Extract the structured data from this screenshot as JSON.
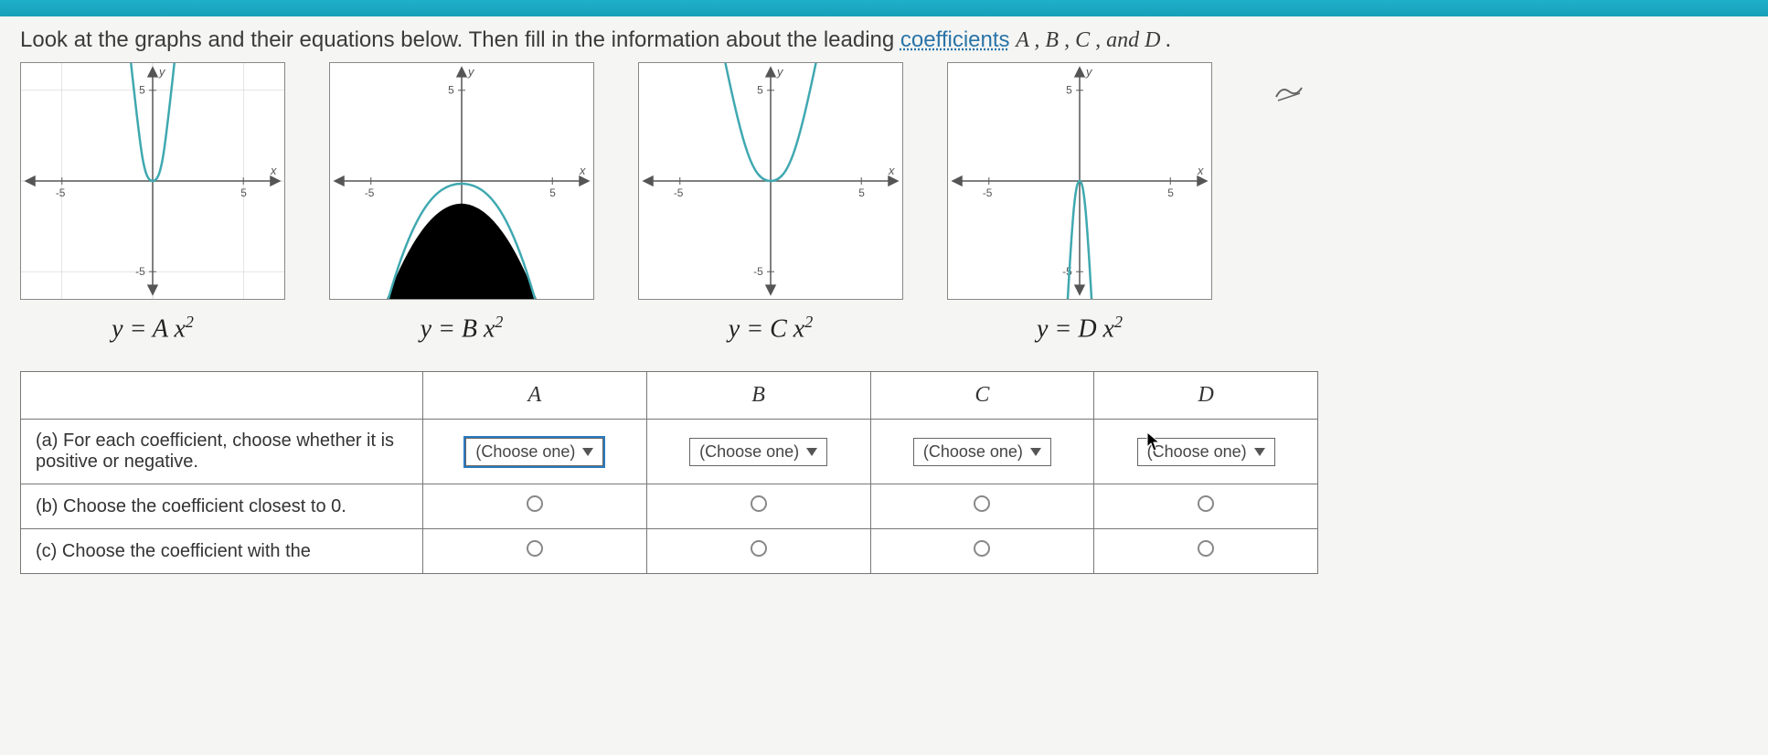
{
  "instruction_prefix": "Look at the graphs and their equations below. Then fill in the information about the leading ",
  "instruction_link": "coefficients",
  "instruction_suffix_vars": " A , B , C , and D .",
  "graphs": [
    {
      "equation_lhs": "y = A x",
      "exp": "2"
    },
    {
      "equation_lhs": "y = B x",
      "exp": "2"
    },
    {
      "equation_lhs": "y = C x",
      "exp": "2"
    },
    {
      "equation_lhs": "y = D x",
      "exp": "2"
    }
  ],
  "axis": {
    "pos_tick": "5",
    "neg_tick": "-5",
    "ylabel": "y",
    "xlabel": "x"
  },
  "columns": [
    "A",
    "B",
    "C",
    "D"
  ],
  "rows": {
    "a": "(a) For each coefficient, choose whether it is positive or negative.",
    "b": "(b) Choose the coefficient closest to 0.",
    "c": "(c) Choose the coefficient with the"
  },
  "dropdown_label": "(Choose one)",
  "chart_data": [
    {
      "type": "line",
      "title": "y = A x^2",
      "xlim": [
        -7,
        7
      ],
      "ylim": [
        -7,
        7
      ],
      "series": [
        {
          "name": "A",
          "coefficient_sign": "positive",
          "coefficient_estimate": 5,
          "x": [
            -1.2,
            -1,
            -0.5,
            0,
            0.5,
            1,
            1.2
          ],
          "y": [
            7.2,
            5,
            1.25,
            0,
            1.25,
            5,
            7.2
          ]
        }
      ]
    },
    {
      "type": "line",
      "title": "y = B x^2",
      "xlim": [
        -7,
        7
      ],
      "ylim": [
        -7,
        7
      ],
      "series": [
        {
          "name": "B",
          "coefficient_sign": "negative",
          "coefficient_estimate": -0.5,
          "x": [
            -4,
            -3,
            -2,
            -1,
            0,
            1,
            2,
            3,
            4
          ],
          "y": [
            -8,
            -4.5,
            -2,
            -0.5,
            0,
            -0.5,
            -2,
            -4.5,
            -8
          ]
        }
      ]
    },
    {
      "type": "line",
      "title": "y = C x^2",
      "xlim": [
        -7,
        7
      ],
      "ylim": [
        -7,
        7
      ],
      "series": [
        {
          "name": "C",
          "coefficient_sign": "positive",
          "coefficient_estimate": 1,
          "x": [
            -2.6,
            -2,
            -1,
            0,
            1,
            2,
            2.6
          ],
          "y": [
            6.76,
            4,
            1,
            0,
            1,
            4,
            6.76
          ]
        }
      ]
    },
    {
      "type": "line",
      "title": "y = D x^2",
      "xlim": [
        -7,
        7
      ],
      "ylim": [
        -7,
        7
      ],
      "series": [
        {
          "name": "D",
          "coefficient_sign": "negative",
          "coefficient_estimate": -8,
          "x": [
            -1,
            -0.7,
            -0.4,
            0,
            0.4,
            0.7,
            1
          ],
          "y": [
            -8,
            -3.92,
            -1.28,
            0,
            -1.28,
            -3.92,
            -8
          ]
        }
      ]
    }
  ]
}
